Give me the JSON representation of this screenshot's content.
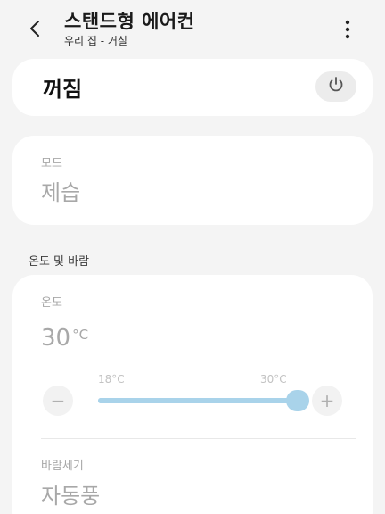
{
  "header": {
    "title": "스탠드형 에어컨",
    "subtitle": "우리 집 - 거실"
  },
  "power": {
    "label": "꺼짐",
    "is_on": false
  },
  "mode": {
    "label": "모드",
    "value": "제습"
  },
  "section_title": "온도 및 바람",
  "temperature": {
    "label": "온도",
    "value": "30",
    "unit": "°C",
    "min_label": "18°C",
    "max_label": "30°C",
    "min_value": 18,
    "max_value": 30,
    "current": 30,
    "minus_symbol": "−",
    "plus_symbol": "+"
  },
  "wind": {
    "label": "바람세기",
    "value": "자동풍"
  },
  "colors": {
    "background": "#f4f4f4",
    "card": "#ffffff",
    "disabled_text": "#a8a8a8",
    "slider": "#a9d3ea"
  }
}
